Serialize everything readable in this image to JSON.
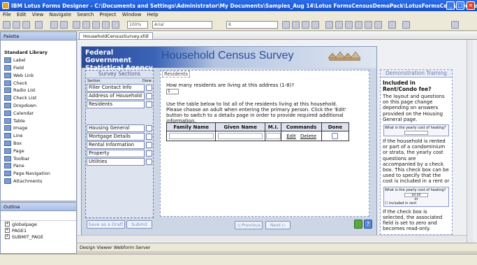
{
  "window": {
    "title": "IBM Lotus Forms Designer - C:\\Documents and Settings\\Administrator\\My Documents\\Samples_Aug 14\\Lotus FormsCensusDemoPack\\LotusFormsCensusDemoPack\\forms\\HouseholdCensu..."
  },
  "menu": [
    "File",
    "Edit",
    "View",
    "Navigate",
    "Search",
    "Project",
    "Window",
    "Help"
  ],
  "toolbar": {
    "zoom": "100%",
    "font": "Arial",
    "size": "8"
  },
  "palette": {
    "title": "Palette",
    "group": "Standard Library",
    "items": [
      "Label",
      "Field",
      "Web Link",
      "Check",
      "Radio List",
      "Check List",
      "Dropdown",
      "Calendar",
      "Table",
      "Image",
      "Line",
      "Box",
      "Page",
      "Toolbar",
      "Pane",
      "Page Navigation",
      "Attachments"
    ]
  },
  "outline": {
    "title": "Outline",
    "items": [
      "globalpage",
      "PAGE1",
      "SUBMIT_PAGE"
    ]
  },
  "editor": {
    "tab": "HouseholdCensusSurvey.xfdl"
  },
  "form": {
    "agency": "Federal Government Statistical Agency",
    "title": "Household Census Survey",
    "sections": {
      "heading": "Survey Sections",
      "col_section": "Section",
      "col_done": "Done",
      "items": [
        "Filler Contact Info",
        "Address of Household",
        "Residents",
        "Housing General",
        "Mortgage Details",
        "Rental Information",
        "Property",
        "Utilities"
      ]
    },
    "buttons": {
      "save_draft": "Save as a Draft",
      "submit": "Submit",
      "previous": "Previous",
      "next": "Next",
      "help": "?"
    },
    "residents": {
      "legend": "Residents",
      "question": "How many residents are living at this address (1-8)?",
      "answer": "1",
      "instructions": "Use the table below to list all of the residents living at this household. Please choose an adult when entering the primary person. Click the 'Edit' button to switch to a details page in order to provide required additional information.",
      "columns": [
        "Family Name",
        "Given Name",
        "M.I.",
        "Commands",
        "Done"
      ],
      "edit": "Edit",
      "delete": "Delete"
    }
  },
  "training": {
    "heading": "Demonstration Training",
    "title": "Included in Rent/Condo fee?",
    "p1": "The layout and questions on this page change depending on answers provided on the Housing General page.",
    "mini1_label": "What is the yearly cost of heating?",
    "p2": "If the household is rented or part of a condominium or strata, the yearly cost questions are accompanied by a check box. This check box can be used to specify that the cost is included in a rent or",
    "mini2_label": "What is the yearly cost of heating?",
    "mini2_value": "$0.00",
    "mini2_or": "or",
    "mini2_check": "Included in rent",
    "p3": "If the check box is selected, the associated field is set to zero and becomes read-only."
  },
  "bottom_tabs": [
    "Design",
    "Viewer",
    "Webform Server"
  ]
}
